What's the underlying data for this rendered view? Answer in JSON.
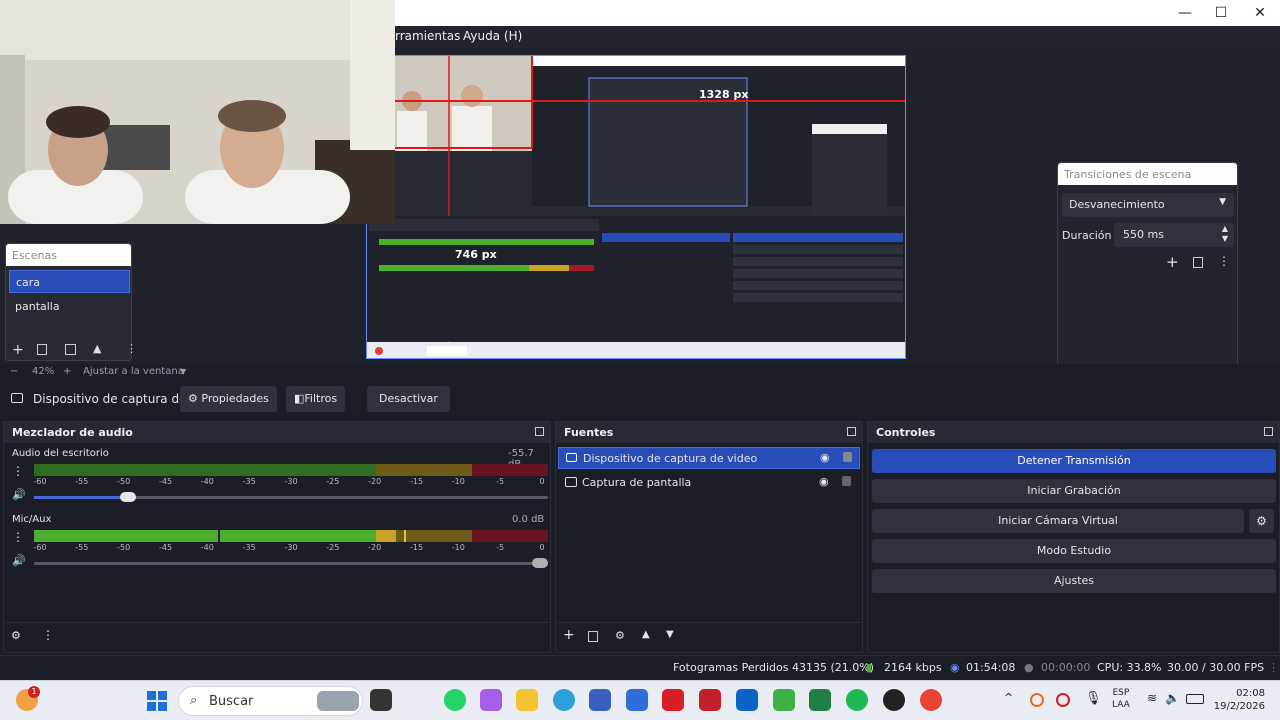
{
  "menubar": {
    "tools": "rramientas",
    "help": "Ayuda (H)"
  },
  "window_controls": {
    "minimize": "—",
    "maximize": "☐",
    "close": "✕"
  },
  "preview": {
    "overlay_width": "1328 px",
    "overlay_height": "746 px"
  },
  "scenes": {
    "title": "Escenas",
    "items": [
      "cara",
      "pantalla"
    ]
  },
  "transitions": {
    "title": "Transiciones de escena",
    "type": "Desvanecimiento",
    "duration_label": "Duración",
    "duration_value": "550 ms"
  },
  "zoom": {
    "level": "42%",
    "fit": "Ajustar a la ventana"
  },
  "source_toolbar": {
    "source_name": "Dispositivo de captura de v",
    "properties": "Propiedades",
    "filters": "Filtros",
    "deactivate": "Desactivar"
  },
  "audio_mixer": {
    "title": "Mezclador de audio",
    "channels": [
      {
        "name": "Audio del escritorio",
        "db": "-55.7 dB",
        "level_percent": 0,
        "volume_percent": 18
      },
      {
        "name": "Mic/Aux",
        "db": "0.0 dB",
        "level_percent": 72,
        "volume_percent": 100
      }
    ],
    "scale": [
      "-60",
      "-55",
      "-50",
      "-45",
      "-40",
      "-35",
      "-30",
      "-25",
      "-20",
      "-15",
      "-10",
      "-5",
      "0"
    ]
  },
  "sources": {
    "title": "Fuentes",
    "items": [
      "Dispositivo de captura de video",
      "Captura de pantalla"
    ]
  },
  "controls": {
    "title": "Controles",
    "stop_stream": "Detener Transmisión",
    "start_recording": "Iniciar Grabación",
    "start_virtual_cam": "Iniciar Cámara Virtual",
    "studio_mode": "Modo Estudio",
    "settings": "Ajustes"
  },
  "status": {
    "dropped_frames": "Fotogramas Perdidos 43135 (21.0%)",
    "bitrate": "2164 kbps",
    "stream_time": "01:54:08",
    "rec_time": "00:00:00",
    "cpu": "CPU: 33.8%",
    "fps": "30.00 / 30.00 FPS"
  },
  "taskbar": {
    "search": "Buscar",
    "lang": "ESP",
    "region": "LAA",
    "time": "02:08",
    "date": "19/2/2026",
    "notif_badge": "1"
  },
  "colors": {
    "accent": "#284cb8",
    "meter_green": "#4caf31",
    "meter_yellow": "#c9a227",
    "meter_red": "#a01a28"
  }
}
